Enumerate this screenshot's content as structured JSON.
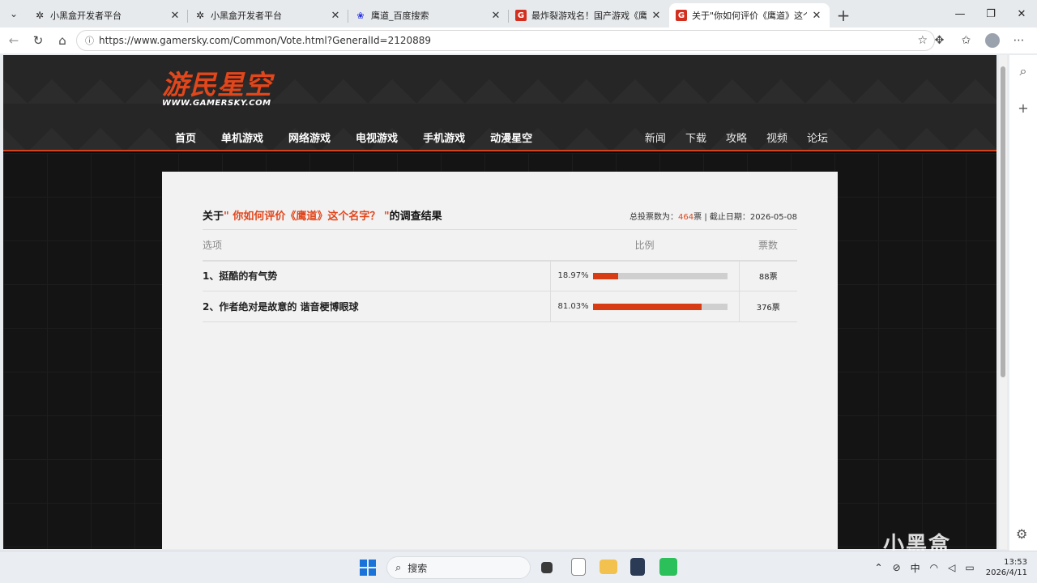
{
  "browser": {
    "tabs": [
      {
        "title": "小黑盒开发者平台",
        "favicon": "heybox-icon"
      },
      {
        "title": "小黑盒开发者平台",
        "favicon": "heybox-icon"
      },
      {
        "title": "鹰道_百度搜索",
        "favicon": "baidu-icon"
      },
      {
        "title": "最炸裂游戏名！国产游戏《鹰道》",
        "favicon": "gamersky-icon"
      },
      {
        "title": "关于\"你如何评价《鹰道》这个名字",
        "favicon": "gamersky-icon",
        "active": true
      }
    ],
    "url": "https://www.gamersky.com/Common/Vote.html?GeneralId=2120889"
  },
  "site": {
    "logo_cn": "游民星空",
    "logo_en": "WWW.GAMERSKY.COM",
    "main_nav": [
      "首页",
      "单机游戏",
      "网络游戏",
      "电视游戏",
      "手机游戏",
      "动漫星空"
    ],
    "sub_nav": [
      "新闻",
      "下载",
      "攻略",
      "视频",
      "论坛"
    ]
  },
  "poll": {
    "title_prefix": "关于",
    "title_question": "\" 你如何评价《鹰道》这个名字？ \"",
    "title_suffix": "的调查结果",
    "meta_total_label": "总投票数为：",
    "meta_total": "464",
    "meta_total_unit": "票 | 截止日期：",
    "meta_date": "2026-05-08",
    "headers": {
      "option": "选项",
      "ratio": "比例",
      "votes": "票数"
    },
    "rows": [
      {
        "option": "1、挺酷的有气势",
        "percent": "18.97%",
        "fraction": 0.1897,
        "votes": "88票"
      },
      {
        "option": "2、作者绝对是故意的 谐音梗博眼球",
        "percent": "81.03%",
        "fraction": 0.8103,
        "votes": "376票"
      }
    ]
  },
  "taskbar": {
    "search_placeholder": "搜索",
    "ime": "中",
    "time": "13:53",
    "date": "2026/4/11"
  },
  "watermark": "小黑盒",
  "colors": {
    "accent": "#e2461b",
    "bar_fill": "#d73c14"
  }
}
